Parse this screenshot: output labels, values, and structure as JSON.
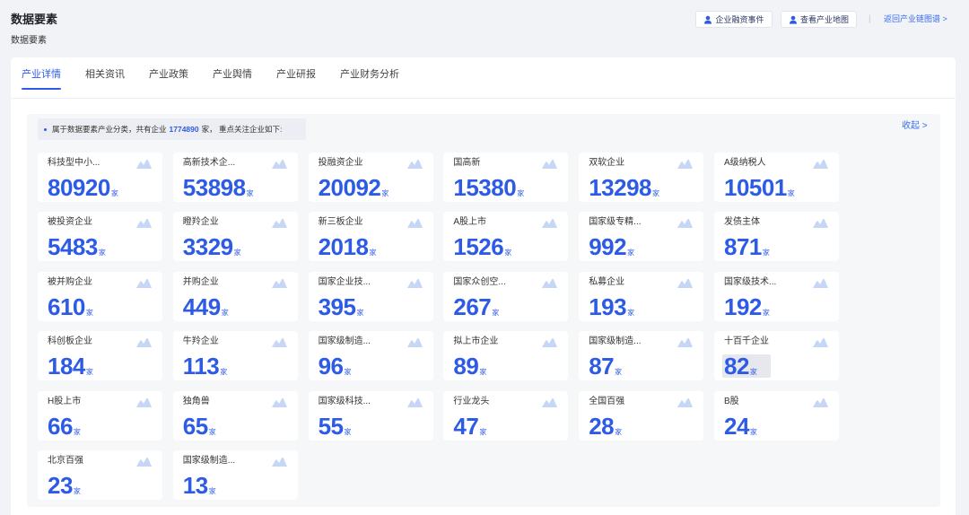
{
  "page": {
    "title": "数据要素",
    "subtitle": "数据要素"
  },
  "actions": {
    "financing_events": {
      "label": "企业融资事件",
      "icon": "user-icon"
    },
    "industry_map": {
      "label": "查看产业地图",
      "icon": "user-icon"
    },
    "divider": "|",
    "back_link": "返回产业链图谱 >"
  },
  "tabs": [
    {
      "label": "产业详情",
      "active": true
    },
    {
      "label": "相关资讯",
      "active": false
    },
    {
      "label": "产业政策",
      "active": false
    },
    {
      "label": "产业舆情",
      "active": false
    },
    {
      "label": "产业研报",
      "active": false
    },
    {
      "label": "产业财务分析",
      "active": false
    }
  ],
  "summary": {
    "text_before": "属于数据要素产业分类，共有企业",
    "total": "1774890",
    "text_after": "家， 重点关注企业如下:"
  },
  "collapse_label": "收起 >",
  "unit": "家",
  "card_icon": "mountain-icon",
  "colors": {
    "accent": "#2d5be6",
    "page_bg": "#f2f3f6",
    "panel_bg": "#f6f7f9",
    "icon_tint": "#c6d6f7"
  },
  "cards": [
    {
      "label": "科技型中小...",
      "value": 80920
    },
    {
      "label": "高新技术企...",
      "value": 53898
    },
    {
      "label": "投融资企业",
      "value": 20092
    },
    {
      "label": "国高新",
      "value": 15380
    },
    {
      "label": "双软企业",
      "value": 13298
    },
    {
      "label": "A级纳税人",
      "value": 10501
    },
    {
      "label": "被投资企业",
      "value": 5483
    },
    {
      "label": "瞪羚企业",
      "value": 3329
    },
    {
      "label": "新三板企业",
      "value": 2018
    },
    {
      "label": "A股上市",
      "value": 1526
    },
    {
      "label": "国家级专精...",
      "value": 992
    },
    {
      "label": "发债主体",
      "value": 871
    },
    {
      "label": "被并购企业",
      "value": 610
    },
    {
      "label": "并购企业",
      "value": 449
    },
    {
      "label": "国家企业技...",
      "value": 395
    },
    {
      "label": "国家众创空...",
      "value": 267
    },
    {
      "label": "私募企业",
      "value": 193
    },
    {
      "label": "国家级技术...",
      "value": 192
    },
    {
      "label": "科创板企业",
      "value": 184
    },
    {
      "label": "牛羚企业",
      "value": 113
    },
    {
      "label": "国家级制造...",
      "value": 96
    },
    {
      "label": "拟上市企业",
      "value": 89
    },
    {
      "label": "国家级制造...",
      "value": 87
    },
    {
      "label": "十百千企业",
      "value": 82,
      "hovered": true
    },
    {
      "label": "H股上市",
      "value": 66
    },
    {
      "label": "独角兽",
      "value": 65
    },
    {
      "label": "国家级科技...",
      "value": 55
    },
    {
      "label": "行业龙头",
      "value": 47
    },
    {
      "label": "全国百强",
      "value": 28
    },
    {
      "label": "B股",
      "value": 24
    },
    {
      "label": "北京百强",
      "value": 23
    },
    {
      "label": "国家级制造...",
      "value": 13
    }
  ]
}
